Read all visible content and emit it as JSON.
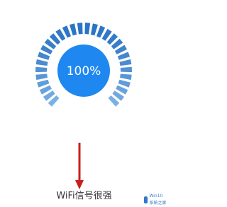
{
  "gauge": {
    "value_text": "100%",
    "level_fraction": 1.0,
    "segments": 30
  },
  "caption": "WiFi信号很强",
  "watermark": {
    "text": "Win10 系统之家"
  },
  "colors": {
    "accent": "#1e88f0",
    "segment_light": "#9cc9ef",
    "segment_dark": "#2a74c6",
    "arrow": "#c81e1e"
  }
}
